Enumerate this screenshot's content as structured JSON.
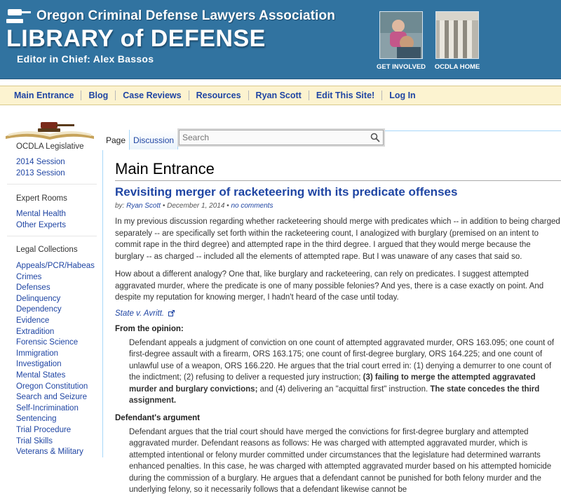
{
  "header": {
    "org_name": "Oregon Criminal Defense Lawyers Association",
    "site_title": "LIBRARY of DEFENSE",
    "editor": "Editor in Chief: Alex Bassos",
    "tiles": [
      {
        "caption": "GET INVOLVED"
      },
      {
        "caption": "OCDLA HOME"
      }
    ]
  },
  "nav": {
    "items": [
      "Main Entrance",
      "Blog",
      "Case Reviews",
      "Resources",
      "Ryan Scott",
      "Edit This Site!",
      "Log In"
    ]
  },
  "sidebar": {
    "sections": [
      {
        "heading": "OCDLA Legislative",
        "items": [
          "2014 Session",
          "2013 Session"
        ]
      },
      {
        "heading": "Expert Rooms",
        "items": [
          "Mental Health",
          "Other Experts"
        ]
      },
      {
        "heading": "Legal Collections",
        "items": [
          "Appeals/PCR/Habeas",
          "Crimes",
          "Defenses",
          "Delinquency",
          "Dependency",
          "Evidence",
          "Extradition",
          "Forensic Science",
          "Immigration",
          "Investigation",
          "Mental States",
          "Oregon Constitution",
          "Search and Seizure",
          "Self-Incrimination",
          "Sentencing",
          "Trial Procedure",
          "Trial Skills",
          "Veterans & Military"
        ]
      }
    ]
  },
  "tabs": [
    "Page",
    "Discussion"
  ],
  "search": {
    "placeholder": "Search"
  },
  "page_title": "Main Entrance",
  "post": {
    "title": "Revisiting merger of racketeering with its predicate offenses",
    "by": "by:",
    "author": "Ryan Scott",
    "date": " • December 1, 2014 • ",
    "comments": "no comments",
    "para1": "In my previous discussion regarding whether racketeering should merge with predicates which -- in addition to being charged separately -- are specifically set forth within the racketeering count, I analogized with burglary (premised on an intent to commit rape in the third degree) and attempted rape in the third degree. I argued that they would merge because the burglary -- as charged -- included all the elements of attempted rape. But I was unaware of any cases that said so.",
    "para2": "How about a different analogy? One that, like burglary and racketeering, can rely on predicates. I suggest attempted aggravated murder, where the predicate is one of many possible felonies? And yes, there is a case exactly on point. And despite my reputation for knowing merger, I hadn't heard of the case until today.",
    "case_link": "State v. Avritt.",
    "opinion_heading": "From the opinion:",
    "quote1_a": "Defendant appeals a judgment of conviction on one count of attempted aggravated murder, ORS 163.095; one count of first-degree assault with a firearm, ORS 163.175; one count of first-degree burglary, ORS 164.225; and one count of unlawful use of a weapon, ORS 166.220. He argues that the trial court erred in: (1) denying a demurrer to one count of the indictment; (2) refusing to deliver a requested jury instruction; ",
    "quote1_b": "(3) failing to merge the attempted aggravated murder and burglary convictions;",
    "quote1_c": " and (4) delivering an \"acquittal first\" instruction. ",
    "quote1_d": "The state concedes the third assignment.",
    "argument_heading": "Defendant's argument",
    "quote2": "Defendant argues that the trial court should have merged the convictions for first-degree burglary and attempted aggravated murder. Defendant reasons as follows: He was charged with attempted aggravated murder, which is attempted intentional or felony murder committed under circumstances that the legislature had determined warrants enhanced penalties. In this case, he was charged with attempted aggravated murder based on his attempted homicide during the commission of a burglary. He argues that a defendant cannot be punished for both felony murder and the underlying felony, so it necessarily follows that a defendant likewise cannot be"
  },
  "colors": {
    "header_bg": "#3173a0",
    "nav_bg": "#fcf3d0",
    "link": "#1f45a3",
    "tab_border": "#a7d7f9"
  }
}
